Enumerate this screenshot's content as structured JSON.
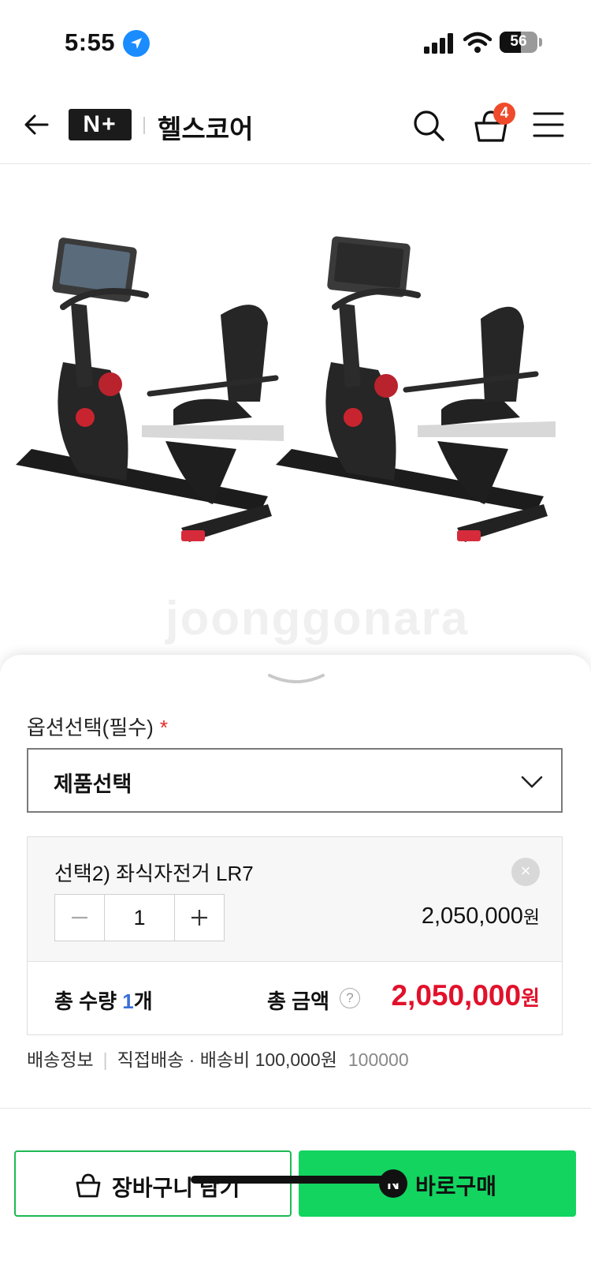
{
  "status_bar": {
    "time": "5:55",
    "battery_percent": "56"
  },
  "header": {
    "logo": "N+",
    "store_name": "헬스코어",
    "cart_count": "4",
    "icons": [
      "back-arrow-icon",
      "search-icon",
      "cart-icon",
      "menu-icon"
    ]
  },
  "hero": {
    "watermark": "joonggonara"
  },
  "options": {
    "label": "옵션선택(필수)",
    "required_mark": "*",
    "select_value": "제품선택"
  },
  "selected_item": {
    "name": "선택2) 좌식자전거 LR7",
    "quantity": "1",
    "price": "2,050,000",
    "price_unit": "원",
    "minus": "−",
    "plus": "+",
    "remove": "×"
  },
  "totals": {
    "quantity_label_prefix": "총 수량 ",
    "quantity_value": "1",
    "quantity_unit": "개",
    "amount_label": "총 금액",
    "help": "?",
    "amount": "2,050,000",
    "amount_unit": "원"
  },
  "shipping": {
    "label": "배송정보",
    "method": "직접배송 · 배송비 100,000원",
    "extra": "100000"
  },
  "actions": {
    "cart_label": "장바구니 담기",
    "buy_label": "바로구매",
    "buy_icon_letter": "N"
  },
  "colors": {
    "accent_green": "#12d45f",
    "price_red": "#e2112b",
    "badge": "#f04a2c"
  }
}
